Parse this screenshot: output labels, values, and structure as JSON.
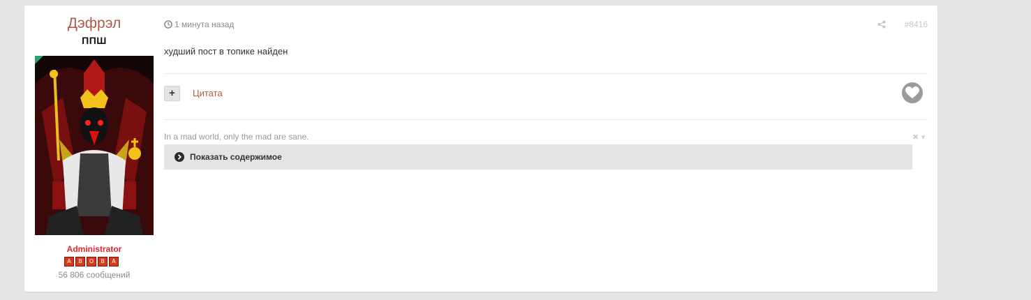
{
  "author": {
    "username": "Дэфрэл",
    "user_title": "ППШ",
    "group": "Administrator",
    "rank_pips": [
      "А",
      "В",
      "О",
      "В",
      "А"
    ],
    "post_count": "56 806 сообщений"
  },
  "post": {
    "timestamp": "1 минута назад",
    "post_id": "#8416",
    "body": "худший пост в топике найден",
    "quote_label": "Цитата",
    "multiquote_label": "+",
    "signature": "In a mad world, only the mad are sane.",
    "signature_controls": "✖ ▾",
    "spoiler_label": "Показать содержимое"
  },
  "icons": {
    "clock": "clock-icon",
    "share": "share-icon",
    "heart": "heart-icon",
    "spoiler": "chevron-right-circle-icon"
  },
  "colors": {
    "username": "#ad5a4a",
    "group": "#e3242b",
    "quote_link": "#b35a45",
    "online": "#2fa06b"
  }
}
